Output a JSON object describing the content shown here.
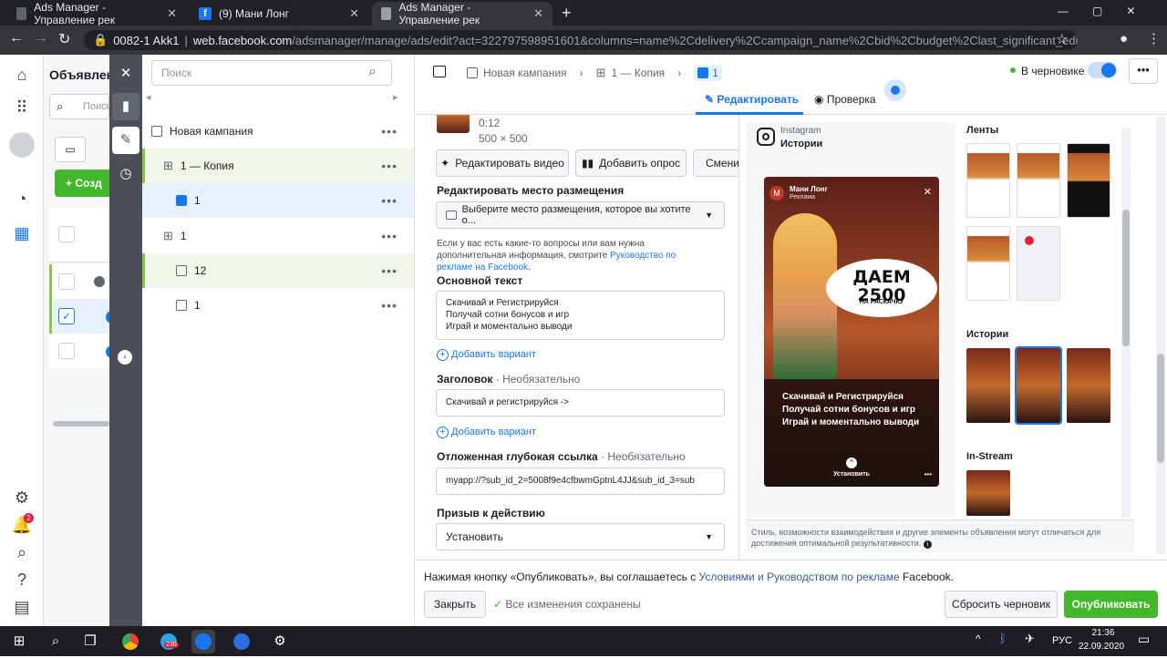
{
  "browser": {
    "tabs": [
      {
        "title": "Ads Manager - Управление рек"
      },
      {
        "title": "(9) Мани Лонг"
      },
      {
        "title": "Ads Manager - Управление рек"
      }
    ],
    "account_chip": "0082-1 Akk1",
    "url_host": "web.facebook.com",
    "url_path": "/adsmanager/manage/ads/edit?act=322797598951601&columns=name%2Cdelivery%2Ccampaign_name%2Cbid%2Cbudget%2Clast_significant_edit%2Cresult..."
  },
  "bg_panel": {
    "title": "Объявлен",
    "search": "Поиск",
    "create": "Созд"
  },
  "tree": {
    "search_placeholder": "Поиск",
    "rows": [
      {
        "label": "Новая кампания"
      },
      {
        "label": "1 — Копия"
      },
      {
        "label": "1"
      },
      {
        "label": "1"
      },
      {
        "label": "12"
      },
      {
        "label": "1"
      }
    ]
  },
  "header": {
    "crumbs": [
      "Новая кампания",
      "1 — Копия",
      "1"
    ],
    "draft_label": "В черновике",
    "tab_edit": "Редактировать",
    "tab_review": "Проверка"
  },
  "form": {
    "media_duration": "0:12",
    "media_size": "500 × 500",
    "btn_edit_video": "Редактировать видео",
    "btn_add_poll": "Добавить опрос",
    "btn_replace": "Сменить",
    "placement_label": "Редактировать место размещения",
    "placement_select": "Выберите место размещения, которое вы хотите о...",
    "help_text": "Если у вас есть какие-то вопросы или вам нужна дополнительная информация, смотрите ",
    "help_link": "Руководство по рекламе на Facebook",
    "primary_text_label": "Основной текст",
    "primary_text_lines": [
      "Скачивай и Регистрируйся",
      "Получай сотни бонусов и игр",
      "Играй и моментально выводи"
    ],
    "add_variant": "Добавить вариант",
    "headline_label": "Заголовок",
    "optional": "· Необязательно",
    "headline_value": "Скачивай и регистрируйся ->",
    "deeplink_label": "Отложенная глубокая ссылка",
    "deeplink_value": "myapp://?sub_id_2=5008f9e4cfbwmGptnL4JJ&sub_id_3=sub",
    "cta_label": "Призыв к действию",
    "cta_value": "Установить"
  },
  "preview": {
    "platform": "Instagram",
    "placement": "Истории",
    "page_name": "Мани Лонг",
    "sponsored": "Реклама",
    "creative_big": "ДАЕМ 2500",
    "creative_small": "НА РАСКАЧКУ",
    "caption": "Скачивай и Регистрируйся Получай сотни бонусов и игр Играй и моментально выводи",
    "install": "Установить",
    "section_feeds": "Ленты",
    "section_stories": "Истории",
    "section_instream": "In-Stream",
    "disclaimer": "Стиль, возможности взаимодействия и другие элементы объявления могут отличаться для достижения оптимальной результативности."
  },
  "footer": {
    "terms_prefix": "Нажимая кнопку «Опубликовать», вы соглашаетесь с ",
    "terms_link": "Условиями и Руководством по рекламе",
    "terms_suffix": " Facebook.",
    "close": "Закрыть",
    "saved": "Все изменения сохранены",
    "reset": "Сбросить черновик",
    "publish": "Опубликовать"
  },
  "taskbar": {
    "telegram_badge": "230",
    "lang": "РУС",
    "time": "21:36",
    "date": "22.09.2020"
  },
  "notif_badge": "2",
  "colors": {
    "accent": "#1877f2",
    "publish": "#42b72a",
    "dark_strip": "#4b4f56"
  }
}
